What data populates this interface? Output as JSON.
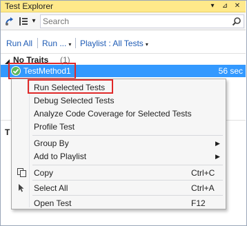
{
  "window": {
    "title": "Test Explorer",
    "dropdown_glyph": "▾",
    "pin_glyph": "⊿",
    "close_glyph": "✕"
  },
  "toolbar": {
    "search_placeholder": "Search",
    "icons": [
      "run-all-icon",
      "group-by-icon",
      "search-icon"
    ],
    "group_caret": "▾"
  },
  "actions": {
    "run_all": "Run All",
    "run": "Run ...",
    "playlist": "Playlist : All Tests",
    "caret": "▾"
  },
  "group": {
    "name": "No Traits",
    "count": "(1)",
    "arrow": "◢"
  },
  "test": {
    "name": "TestMethod1",
    "duration": "56 sec",
    "status": "passed",
    "status_color": "#5cb85c",
    "selected_color": "#3399ff"
  },
  "lower_panel": {
    "label": "T"
  },
  "context_menu": {
    "items": [
      {
        "label": "Run Selected Tests",
        "shortcut": "",
        "submenu": false,
        "icon": ""
      },
      {
        "label": "Debug Selected Tests",
        "shortcut": "",
        "submenu": false,
        "icon": ""
      },
      {
        "label": "Analyze Code Coverage for Selected Tests",
        "shortcut": "",
        "submenu": false,
        "icon": ""
      },
      {
        "label": "Profile Test",
        "shortcut": "",
        "submenu": false,
        "icon": ""
      },
      {
        "label": "Group By",
        "shortcut": "",
        "submenu": true,
        "icon": ""
      },
      {
        "label": "Add to Playlist",
        "shortcut": "",
        "submenu": true,
        "icon": ""
      },
      {
        "label": "Copy",
        "shortcut": "Ctrl+C",
        "submenu": false,
        "icon": "copy-icon"
      },
      {
        "label": "Select All",
        "shortcut": "Ctrl+A",
        "submenu": false,
        "icon": "select-all-icon"
      },
      {
        "label": "Open Test",
        "shortcut": "F12",
        "submenu": false,
        "icon": ""
      }
    ],
    "submenu_arrow": "▶"
  },
  "colors": {
    "title_bar": "#ffe98a",
    "link": "#1e5bb5",
    "highlight_box": "#e02828"
  }
}
